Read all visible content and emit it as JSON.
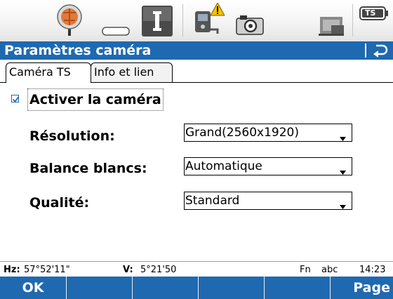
{
  "colors": {
    "accent": "#1f69b0",
    "status_bar_bg": "#f0f0f0",
    "warning": "#f2c200",
    "prism_orange": "#e07a3a"
  },
  "status_bar": {
    "icons": [
      "prism-icon",
      "laser-mode-icon",
      "instrument-face-icon",
      "connection-warning-icon",
      "camera-icon",
      "memory-card-icon",
      "battery-icon"
    ],
    "battery_label": "TS"
  },
  "window": {
    "title": "Paramètres caméra",
    "back_icon": "back-icon"
  },
  "tabs": [
    {
      "label": "Caméra TS",
      "active": true
    },
    {
      "label": "Info et lien",
      "active": false
    }
  ],
  "form": {
    "enable_camera": {
      "label": "Activer la caméra",
      "checked": true
    },
    "fields": [
      {
        "label": "Résolution:",
        "value": "Grand(2560x1920)"
      },
      {
        "label": "Balance blancs:",
        "value": "Automatique"
      },
      {
        "label": "Qualité:",
        "value": "Standard"
      }
    ]
  },
  "bottom_status": {
    "hz_label": "Hz:",
    "hz_value": "57°52'11\"",
    "v_label": "V:",
    "v_value": "5°21'50",
    "fn": "Fn",
    "input_mode": "abc",
    "time": "14:23"
  },
  "softkeys": {
    "f1": "OK",
    "f2": "",
    "f3": "",
    "f4": "",
    "f5": "",
    "f6": "Page"
  }
}
